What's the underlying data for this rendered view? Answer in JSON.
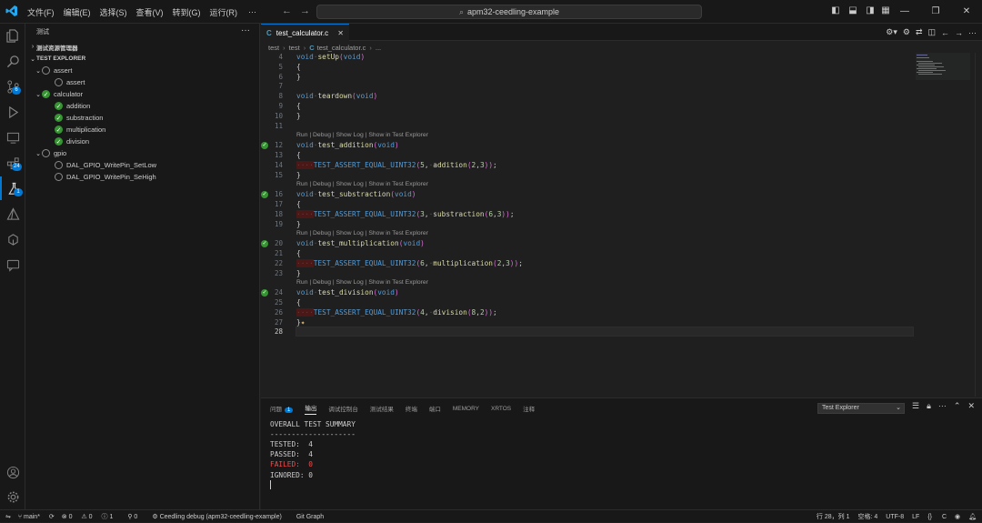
{
  "menu": [
    "文件(F)",
    "编辑(E)",
    "选择(S)",
    "查看(V)",
    "转到(G)",
    "运行(R)",
    "···"
  ],
  "search": {
    "text": "apm32-ceedling-example"
  },
  "activity_badges": {
    "scm": "6",
    "extensions": "24",
    "testing": "1"
  },
  "sidebar": {
    "title": "测试",
    "more": "···",
    "section_resources": "测试资源管理器",
    "section_explorer": "TEST EXPLORER",
    "tree": [
      {
        "label": "assert",
        "status": "none",
        "level": 1,
        "chev": "⌄"
      },
      {
        "label": "assert",
        "status": "none",
        "level": 2,
        "chev": ""
      },
      {
        "label": "calculator",
        "status": "pass",
        "level": 1,
        "chev": "⌄"
      },
      {
        "label": "addition",
        "status": "pass",
        "level": 2,
        "chev": ""
      },
      {
        "label": "substraction",
        "status": "pass",
        "level": 2,
        "chev": ""
      },
      {
        "label": "multiplication",
        "status": "pass",
        "level": 2,
        "chev": ""
      },
      {
        "label": "division",
        "status": "pass",
        "level": 2,
        "chev": ""
      },
      {
        "label": "gpio",
        "status": "none",
        "level": 1,
        "chev": "⌄"
      },
      {
        "label": "DAL_GPIO_WritePin_SetLow",
        "status": "none",
        "level": 2,
        "chev": ""
      },
      {
        "label": "DAL_GPIO_WritePin_SeHigh",
        "status": "none",
        "level": 2,
        "chev": ""
      }
    ]
  },
  "editor": {
    "tab_label": "test_calculator.c",
    "tab_icon": "C",
    "breadcrumb": [
      "test",
      "test",
      "test_calculator.c",
      "..."
    ],
    "codelens": "Run | Debug | Show Log | Show in Test Explorer",
    "lines": [
      {
        "n": "4",
        "t": "void setUp(void)",
        "kind": "fndef"
      },
      {
        "n": "5",
        "t": "{",
        "kind": "brace"
      },
      {
        "n": "6",
        "t": "}",
        "kind": "brace"
      },
      {
        "n": "7",
        "t": "",
        "kind": "empty"
      },
      {
        "n": "8",
        "t": "void teardown(void)",
        "kind": "fndef"
      },
      {
        "n": "9",
        "t": "{",
        "kind": "brace"
      },
      {
        "n": "10",
        "t": "}",
        "kind": "brace"
      },
      {
        "n": "11",
        "t": "",
        "kind": "empty"
      },
      {
        "n": "12",
        "t": "void test_addition(void)",
        "kind": "fndef",
        "lens": true,
        "pass": true
      },
      {
        "n": "13",
        "t": "{",
        "kind": "brace"
      },
      {
        "n": "14",
        "t": "TEST_ASSERT_EQUAL_UINT32(5, addition(2,3));",
        "kind": "assert"
      },
      {
        "n": "15",
        "t": "}",
        "kind": "brace"
      },
      {
        "n": "16",
        "t": "void test_substraction(void)",
        "kind": "fndef",
        "lens": true,
        "pass": true
      },
      {
        "n": "17",
        "t": "{",
        "kind": "brace"
      },
      {
        "n": "18",
        "t": "TEST_ASSERT_EQUAL_UINT32(3, substraction(6,3));",
        "kind": "assert"
      },
      {
        "n": "19",
        "t": "}",
        "kind": "brace"
      },
      {
        "n": "20",
        "t": "void test_multiplication(void)",
        "kind": "fndef",
        "lens": true,
        "pass": true
      },
      {
        "n": "21",
        "t": "{",
        "kind": "brace"
      },
      {
        "n": "22",
        "t": "TEST_ASSERT_EQUAL_UINT32(6, multiplication(2,3));",
        "kind": "assert"
      },
      {
        "n": "23",
        "t": "}",
        "kind": "brace"
      },
      {
        "n": "24",
        "t": "void test_division(void)",
        "kind": "fndef",
        "lens": true,
        "pass": true
      },
      {
        "n": "25",
        "t": "{",
        "kind": "brace"
      },
      {
        "n": "26",
        "t": "TEST_ASSERT_EQUAL_UINT32(4, division(8,2));",
        "kind": "assert"
      },
      {
        "n": "27",
        "t": "}",
        "kind": "brace",
        "sparkle": true
      },
      {
        "n": "28",
        "t": "",
        "kind": "current"
      }
    ]
  },
  "panel": {
    "tabs": [
      "问题",
      "输出",
      "调试控制台",
      "测试结果",
      "终端",
      "端口",
      "MEMORY",
      "XRTOS",
      "注释"
    ],
    "problems_count": "1",
    "active_tab": "输出",
    "output_source": "Test Explorer",
    "output": [
      {
        "t": "OVERALL TEST SUMMARY",
        "fail": false
      },
      {
        "t": "--------------------",
        "fail": false
      },
      {
        "t": "TESTED:  4",
        "fail": false
      },
      {
        "t": "PASSED:  4",
        "fail": false
      },
      {
        "t": "FAILED:  0",
        "fail": true
      },
      {
        "t": "IGNORED: 0",
        "fail": false
      }
    ]
  },
  "status": {
    "branch": "main*",
    "errors": "0",
    "warnings": "0",
    "info": "1",
    "ports": "0",
    "debug": "Ceedling debug (apm32-ceedling-example)",
    "git_graph": "Git Graph",
    "position": "行 28，列 1",
    "spaces": "空格: 4",
    "encoding": "UTF-8",
    "eol": "LF",
    "lang": "C"
  },
  "colors": {
    "accent": "#0078d4",
    "pass": "#369432",
    "fail": "#f14c4c"
  }
}
